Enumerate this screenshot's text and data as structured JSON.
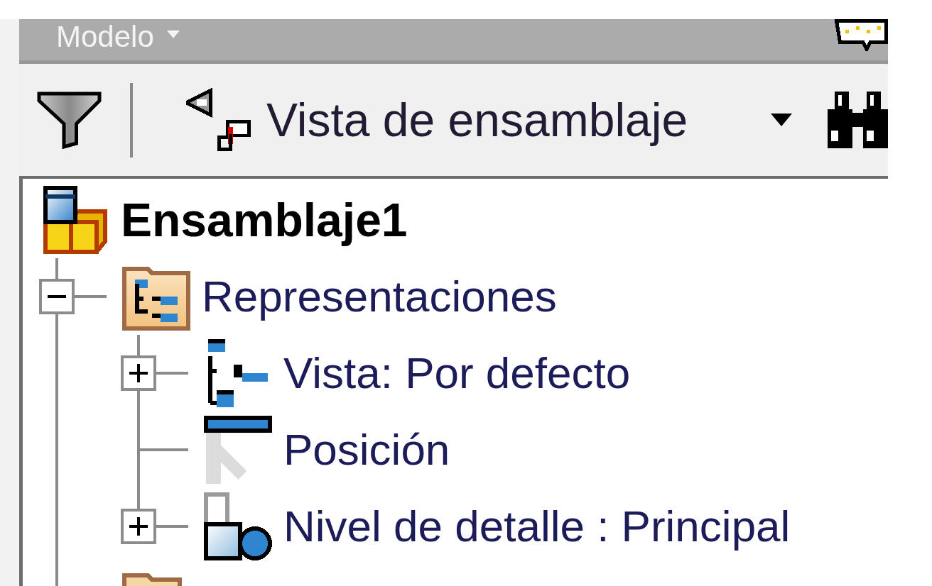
{
  "panel": {
    "title": "Modelo"
  },
  "toolbar": {
    "view_selector": {
      "label": "Vista de ensamblaje"
    }
  },
  "tree": {
    "label": "Ensamblaje1",
    "kind": "assembly",
    "children": [
      {
        "label": "Representaciones",
        "kind": "representations",
        "expanded": true,
        "children": [
          {
            "label": "Vista: Por defecto",
            "kind": "view",
            "expanded": false
          },
          {
            "label": "Posición",
            "kind": "position"
          },
          {
            "label": "Nivel de detalle : Principal",
            "kind": "detail_level",
            "expanded": false
          }
        ]
      },
      {
        "kind": "folder"
      }
    ]
  }
}
